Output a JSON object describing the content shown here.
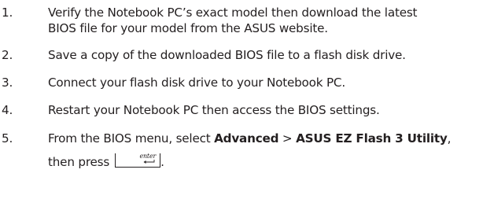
{
  "steps": [
    {
      "number": "1.",
      "line1": "Verify the Notebook PC’s exact model then download the latest",
      "line2": "BIOS file for your model from the ASUS website."
    },
    {
      "number": "2.",
      "text": "Save a copy of the downloaded BIOS file to a flash disk drive."
    },
    {
      "number": "3.",
      "text": "Connect your flash disk drive to your Notebook PC."
    },
    {
      "number": "4.",
      "text": "Restart your Notebook PC then access the BIOS settings."
    },
    {
      "number": "5.",
      "prefix": "From the BIOS menu, select ",
      "menu1": "Advanced",
      "separator": " > ",
      "menu2": "ASUS EZ Flash 3 Utility",
      "suffix": ",",
      "line2_prefix": "then press",
      "line2_suffix": ".",
      "key_label": "enter",
      "key_icon": "enter-arrow-icon"
    }
  ]
}
